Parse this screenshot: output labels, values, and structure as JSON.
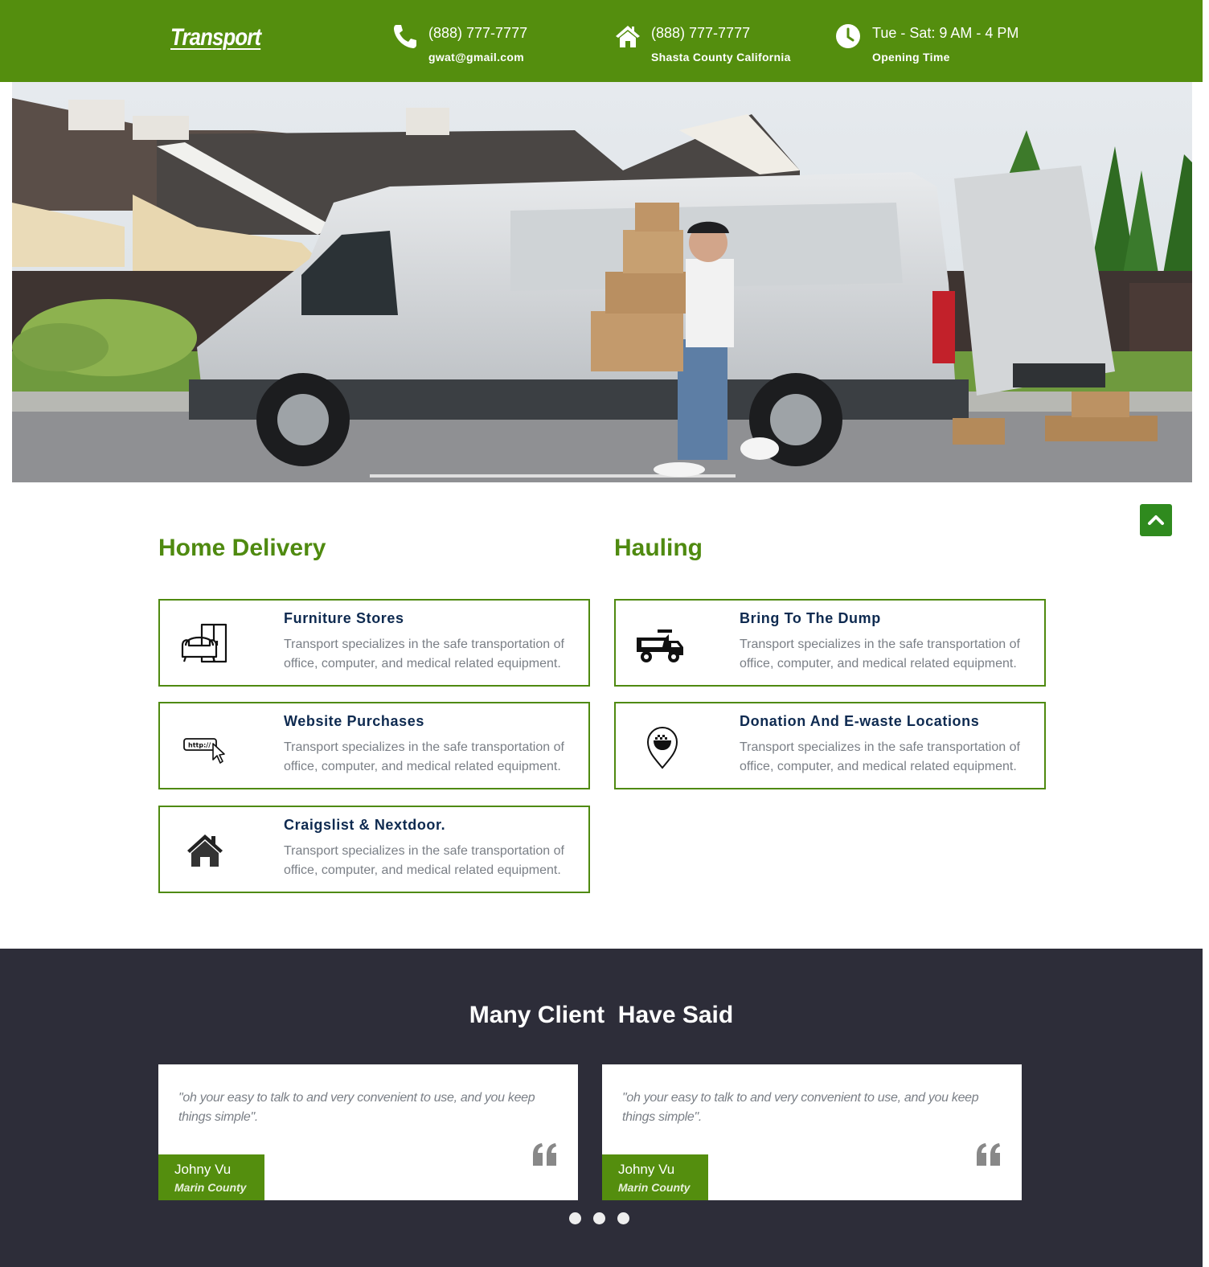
{
  "header": {
    "logo": "Transport",
    "contacts": [
      {
        "icon": "phone-icon",
        "line1": "(888) 777-7777",
        "line2": "gwat@gmail.com"
      },
      {
        "icon": "home-icon",
        "line1": "(888) 777-7777",
        "line2": "Shasta County California"
      },
      {
        "icon": "clock-icon",
        "line1": "Tue - Sat: 9 AM - 4 PM",
        "line2": "Opening Time"
      }
    ]
  },
  "hero": {
    "image": "delivery van with courier carrying boxes"
  },
  "services": {
    "home_delivery": {
      "title": "Home Delivery",
      "items": [
        {
          "icon": "furniture-icon",
          "title": "Furniture Stores",
          "desc": "Transport specializes in the safe transportation of office, computer, and medical related equipment."
        },
        {
          "icon": "website-cursor-icon",
          "title": "Website Purchases",
          "desc": "Transport specializes in the safe transportation of office, computer, and medical related equipment."
        },
        {
          "icon": "house-icon",
          "title": "Craigslist & Nextdoor.",
          "desc": "Transport specializes in the safe transportation of office, computer, and medical related equipment."
        }
      ]
    },
    "hauling": {
      "title": "Hauling",
      "items": [
        {
          "icon": "dump-truck-icon",
          "title": "Bring To The Dump",
          "desc": "Transport specializes in the safe transportation of office, computer, and medical related equipment."
        },
        {
          "icon": "location-pin-icon",
          "title": "Donation And E-waste Locations",
          "desc": "Transport specializes in the safe transportation of office, computer, and medical related equipment."
        }
      ]
    }
  },
  "testimonials": {
    "title": "Many Client  Have Said",
    "items": [
      {
        "quote": "\"oh your easy to talk to and very convenient to use, and you keep things simple\".",
        "name": "Johny Vu",
        "location": "Marin County"
      },
      {
        "quote": "\"oh your easy to talk to and very convenient to use, and you keep things simple\".",
        "name": "Johny Vu",
        "location": "Marin County"
      }
    ],
    "dots": 3
  },
  "colors": {
    "brand_green": "#548e0e",
    "dark_bg": "#2d2d39",
    "title_blue": "#0e2a50"
  }
}
